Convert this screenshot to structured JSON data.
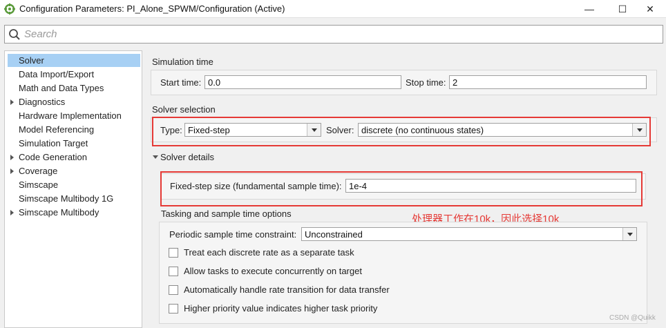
{
  "window": {
    "title": "Configuration Parameters: PI_Alone_SPWM/Configuration (Active)",
    "minimize_glyph": "—",
    "maximize_glyph": "☐",
    "close_glyph": "✕"
  },
  "search": {
    "placeholder": "Search"
  },
  "sidebar": {
    "items": [
      {
        "label": "Solver",
        "selected": true,
        "expandable": false
      },
      {
        "label": "Data Import/Export",
        "expandable": false
      },
      {
        "label": "Math and Data Types",
        "expandable": false
      },
      {
        "label": "Diagnostics",
        "expandable": true
      },
      {
        "label": "Hardware Implementation",
        "expandable": false
      },
      {
        "label": "Model Referencing",
        "expandable": false
      },
      {
        "label": "Simulation Target",
        "expandable": false
      },
      {
        "label": "Code Generation",
        "expandable": true
      },
      {
        "label": "Coverage",
        "expandable": true
      },
      {
        "label": "Simscape",
        "expandable": false
      },
      {
        "label": "Simscape Multibody 1G",
        "expandable": false
      },
      {
        "label": "Simscape Multibody",
        "expandable": true
      }
    ]
  },
  "simulation_time": {
    "heading": "Simulation time",
    "start_label": "Start time:",
    "start_value": "0.0",
    "stop_label": "Stop time:",
    "stop_value": "2"
  },
  "solver_selection": {
    "heading": "Solver selection",
    "type_label": "Type:",
    "type_value": "Fixed-step",
    "solver_label": "Solver:",
    "solver_value": "discrete (no continuous states)"
  },
  "solver_details": {
    "heading": "Solver details",
    "step_label": "Fixed-step size (fundamental sample time):",
    "step_value": "1e-4"
  },
  "tasking": {
    "heading": "Tasking and sample time options",
    "periodic_label": "Periodic sample time constraint:",
    "periodic_value": "Unconstrained",
    "checkboxes": [
      {
        "label": "Treat each discrete rate as a separate task",
        "checked": false
      },
      {
        "label": "Allow tasks to execute concurrently on target",
        "checked": false
      },
      {
        "label": "Automatically handle rate transition for data transfer",
        "checked": false
      },
      {
        "label": "Higher priority value indicates higher task priority",
        "checked": false
      }
    ]
  },
  "annotation": {
    "text": "处理器工作在10k，因此选择10k",
    "color": "#e53935"
  },
  "watermark": "CSDN @Quikk",
  "colors": {
    "selection": "#a7d0f4",
    "highlight_box": "#e53935"
  }
}
